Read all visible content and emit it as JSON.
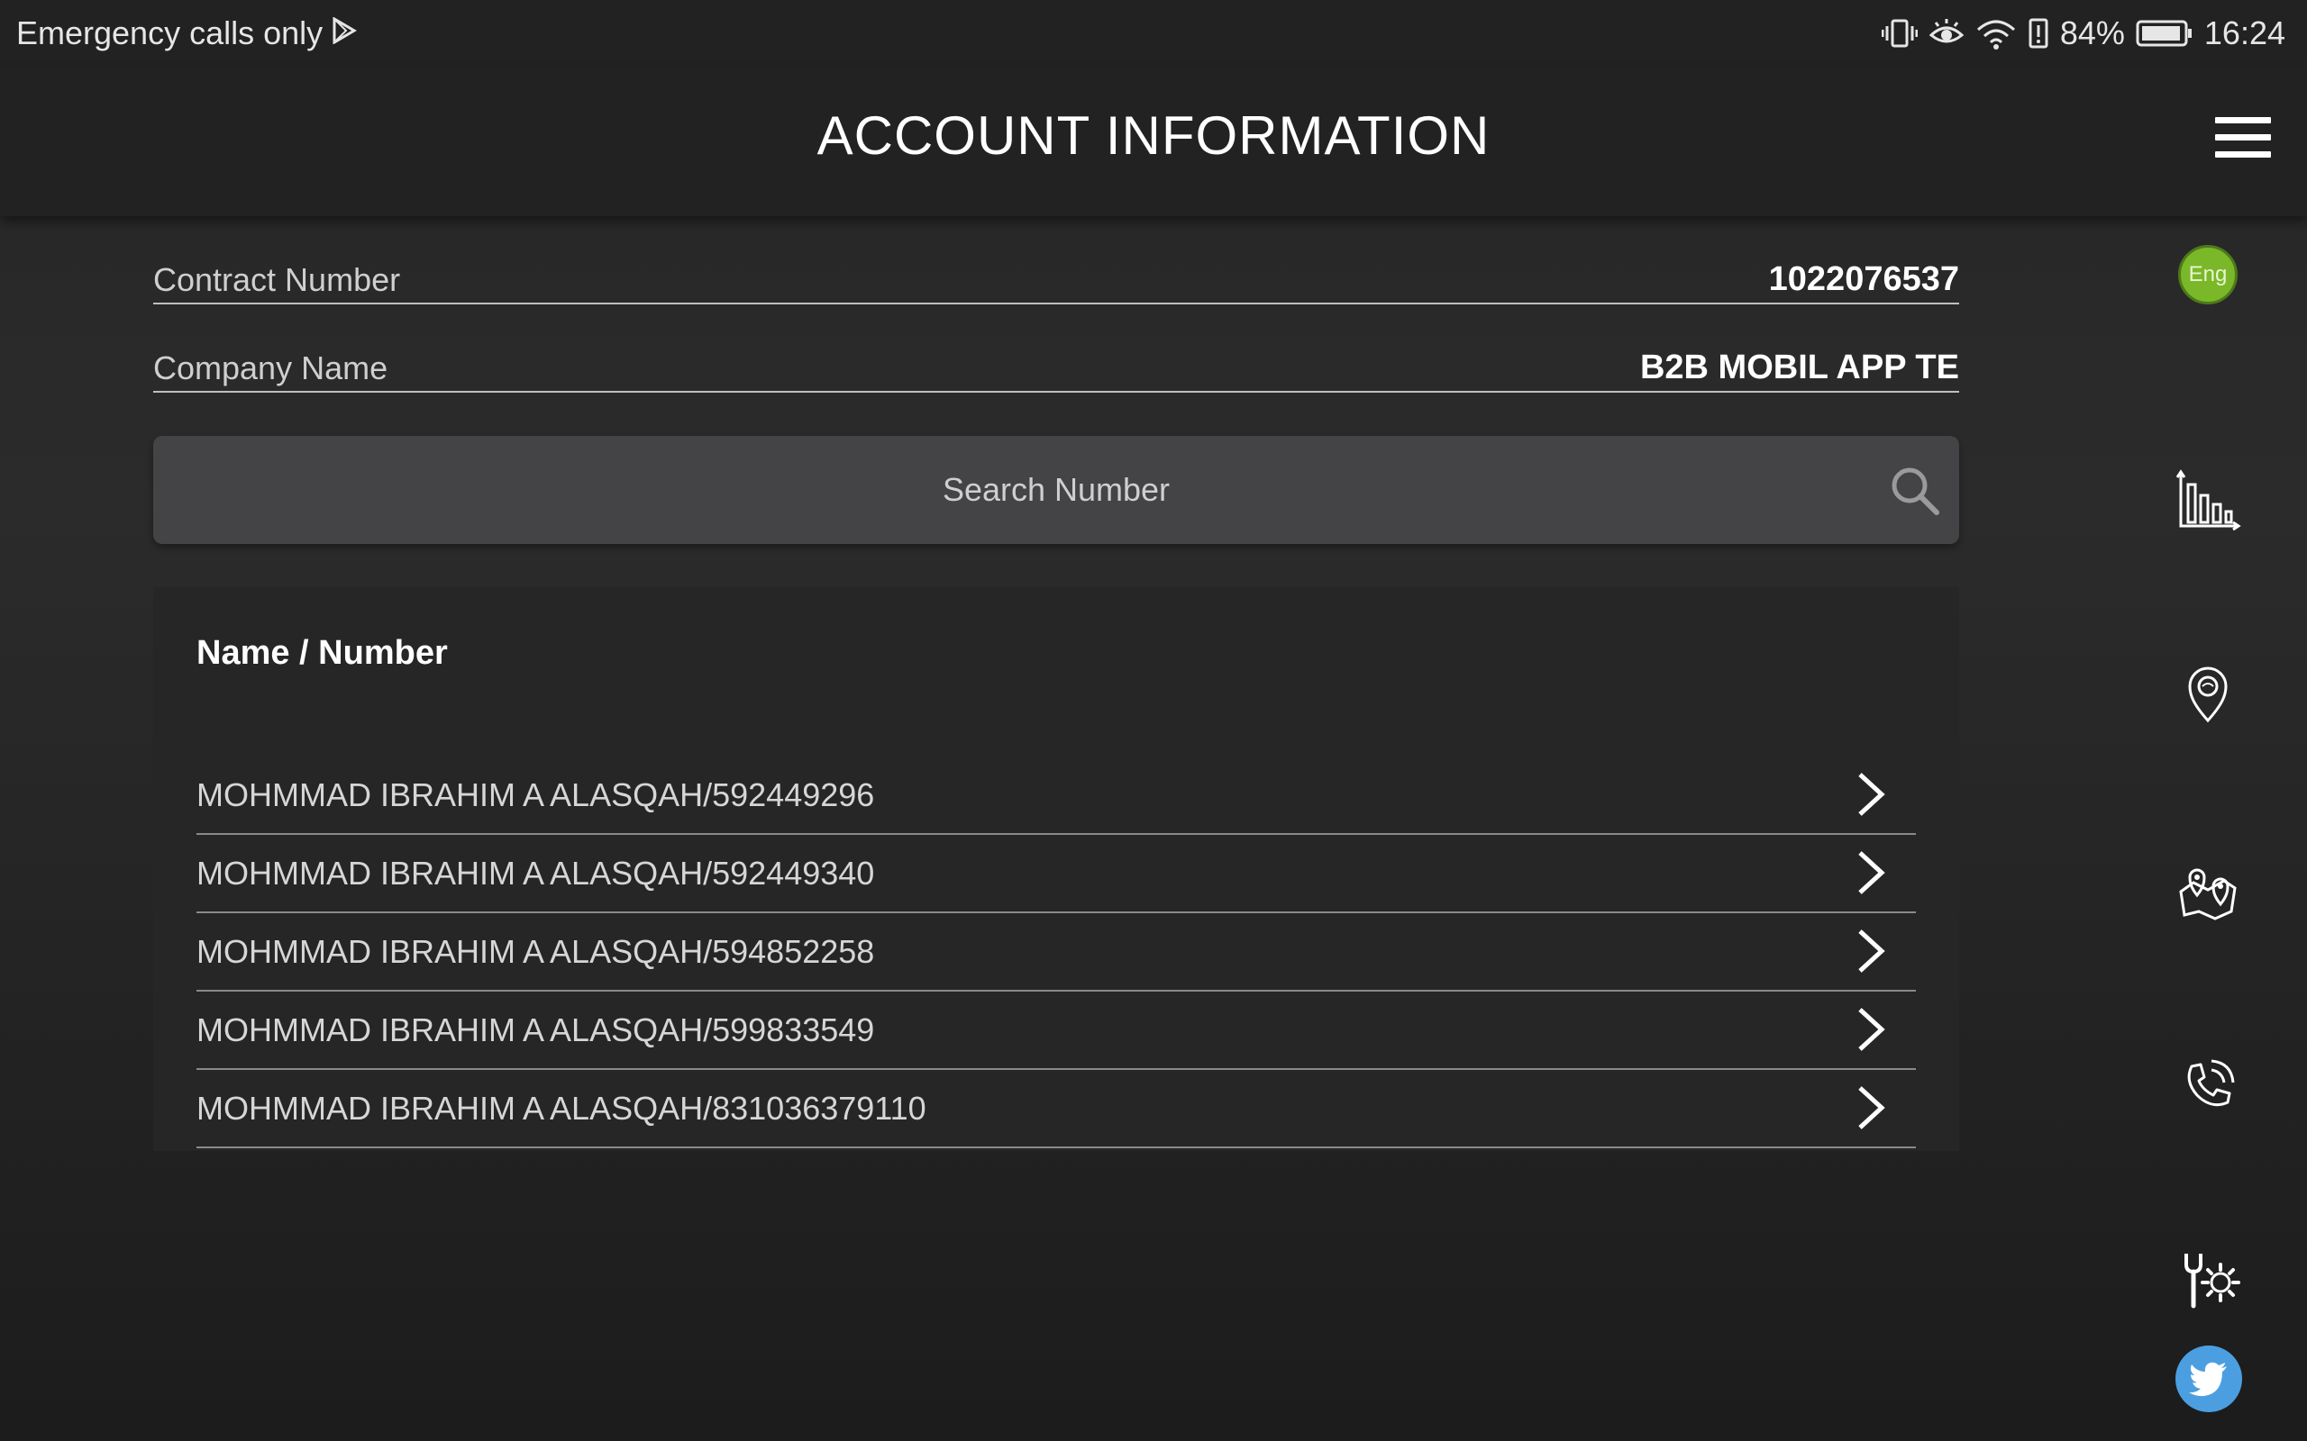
{
  "status_bar": {
    "carrier_text": "Emergency calls only",
    "battery": "84%",
    "time": "16:24",
    "icons": [
      "play-store-icon",
      "vibrate-icon",
      "eye-comfort-icon",
      "wifi-icon",
      "battery-alert-icon",
      "battery-icon"
    ]
  },
  "header": {
    "title": "ACCOUNT INFORMATION",
    "menu_icon": "hamburger-menu-icon"
  },
  "fields": {
    "contract": {
      "label": "Contract Number",
      "value": "1022076537"
    },
    "company": {
      "label": "Company Name",
      "value": "B2B MOBIL APP TE"
    }
  },
  "search": {
    "placeholder": "Search Number",
    "value": "",
    "icon": "search-icon"
  },
  "list": {
    "header": "Name / Number",
    "items": [
      {
        "label": "MOHMMAD IBRAHIM A ALASQAH/592449296"
      },
      {
        "label": "MOHMMAD IBRAHIM A ALASQAH/592449340"
      },
      {
        "label": "MOHMMAD IBRAHIM A ALASQAH/594852258"
      },
      {
        "label": "MOHMMAD IBRAHIM A ALASQAH/599833549"
      },
      {
        "label": "MOHMMAD IBRAHIM A ALASQAH/831036379110"
      }
    ]
  },
  "rail": {
    "language": "Eng",
    "items": [
      "usage-chart-icon",
      "store-location-icon",
      "map-locations-icon",
      "call-support-icon",
      "services-tools-icon",
      "twitter-icon"
    ]
  },
  "colors": {
    "background": "#262626",
    "header": "#222222",
    "search_bg": "#444446",
    "language_badge": "#7ab829",
    "twitter": "#4b9fe0"
  }
}
